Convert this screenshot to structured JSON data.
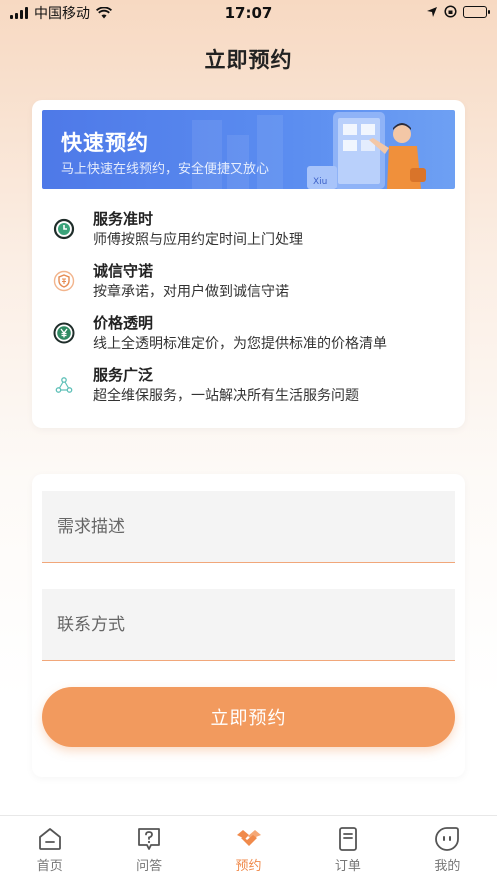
{
  "status_bar": {
    "carrier": "中国移动",
    "time": "17:07"
  },
  "header": {
    "title": "立即预约"
  },
  "banner": {
    "title": "快速预约",
    "subtitle": "马上快速在线预约，安全便捷又放心",
    "art_text": "Xiu"
  },
  "features": [
    {
      "title": "服务准时",
      "desc": "师傅按照与应用约定时间上门处理",
      "icon": "clock-icon"
    },
    {
      "title": "诚信守诺",
      "desc": "按章承诺，对用户做到诚信守诺",
      "icon": "shield-icon"
    },
    {
      "title": "价格透明",
      "desc": "线上全透明标准定价，为您提供标准的价格清单",
      "icon": "yen-icon"
    },
    {
      "title": "服务广泛",
      "desc": "超全维保服务，一站解决所有生活服务问题",
      "icon": "network-icon"
    }
  ],
  "form": {
    "description_placeholder": "需求描述",
    "contact_placeholder": "联系方式",
    "submit_label": "立即预约"
  },
  "tabs": [
    {
      "label": "首页",
      "icon": "home-icon"
    },
    {
      "label": "问答",
      "icon": "question-icon"
    },
    {
      "label": "预约",
      "icon": "handshake-icon",
      "active": true
    },
    {
      "label": "订单",
      "icon": "order-icon"
    },
    {
      "label": "我的",
      "icon": "profile-icon"
    }
  ],
  "colors": {
    "accent": "#f29a5e",
    "banner_blue": "#4e79e8",
    "active_tab": "#f08a4b"
  }
}
